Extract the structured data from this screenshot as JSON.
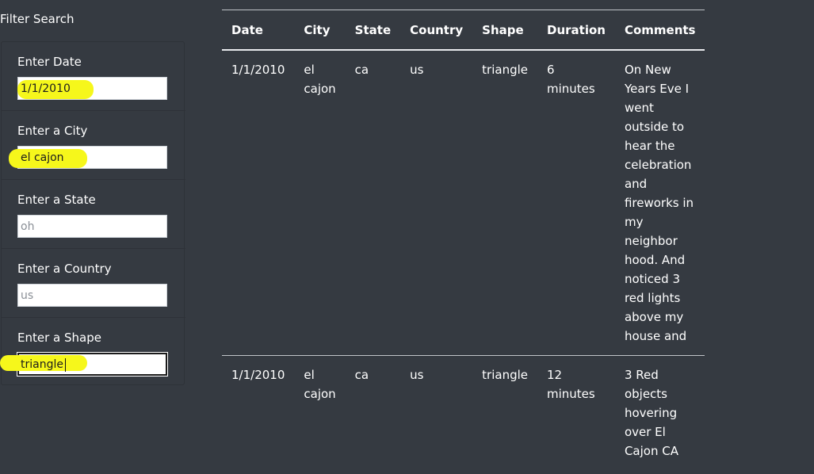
{
  "filter": {
    "title": "Filter Search",
    "fields": [
      {
        "label": "Enter Date",
        "value": "1/1/2010",
        "placeholder": ""
      },
      {
        "label": "Enter a City",
        "value": "el cajon",
        "placeholder": ""
      },
      {
        "label": "Enter a State",
        "value": "",
        "placeholder": "oh"
      },
      {
        "label": "Enter a Country",
        "value": "",
        "placeholder": "us"
      },
      {
        "label": "Enter a Shape",
        "value": "triangle",
        "placeholder": ""
      }
    ],
    "highlight_color": "#f6f71b"
  },
  "table": {
    "headers": [
      "Date",
      "City",
      "State",
      "Country",
      "Shape",
      "Duration",
      "Comments"
    ],
    "rows": [
      {
        "date": "1/1/2010",
        "city": "el cajon",
        "state": "ca",
        "country": "us",
        "shape": "triangle",
        "duration": "6 minutes",
        "comments": "On New Years Eve I went outside to hear the celebration and fireworks in my neighbor hood. And noticed 3 red lights above my house and"
      },
      {
        "date": "1/1/2010",
        "city": "el cajon",
        "state": "ca",
        "country": "us",
        "shape": "triangle",
        "duration": "12 minutes",
        "comments": "3 Red objects hovering over El Cajon CA"
      }
    ]
  },
  "colors": {
    "background": "#353a41",
    "text": "#ffffff"
  }
}
